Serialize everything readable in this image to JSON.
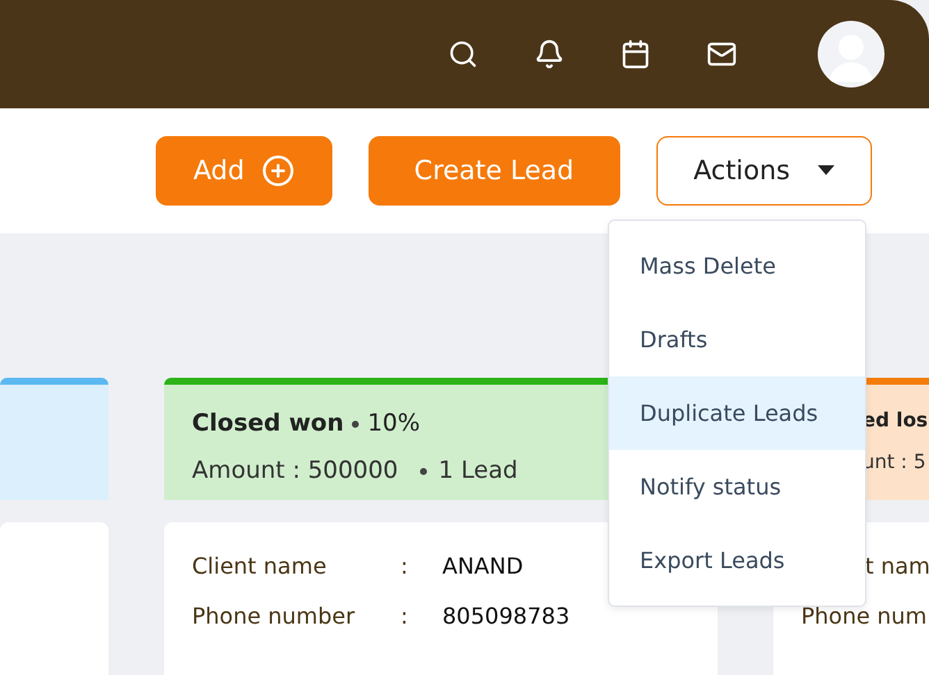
{
  "toolbar": {
    "buttons": [
      {
        "label": "Add",
        "kind": "add"
      },
      {
        "label": "Create Lead",
        "kind": "plain"
      },
      {
        "label": "Actions",
        "kind": "dropdown",
        "expanded": true
      }
    ]
  },
  "actions_menu": [
    {
      "label": "Mass Delete",
      "selected": false
    },
    {
      "label": "Drafts",
      "selected": false
    },
    {
      "label": "Duplicate Leads",
      "selected": true
    },
    {
      "label": "Notify status",
      "selected": false
    },
    {
      "label": "Export Leads",
      "selected": false
    }
  ],
  "columns": [
    {
      "color": "#5bb8f0"
    },
    {
      "color": "#2bb317",
      "title": "Closed won",
      "percent": "10%",
      "amount": "Amount : 500000",
      "count": "1 Lead",
      "card": [
        {
          "label": "Client name",
          "separator": ":",
          "value": "ANAND"
        },
        {
          "label": "Phone number",
          "separator": ":",
          "value": "805098783"
        }
      ]
    },
    {
      "color": "#f57c0a",
      "title": "ed los",
      "amount": "unt : 5",
      "card": [
        {
          "label": "t nam"
        },
        {
          "label": "Phone num"
        }
      ]
    }
  ]
}
